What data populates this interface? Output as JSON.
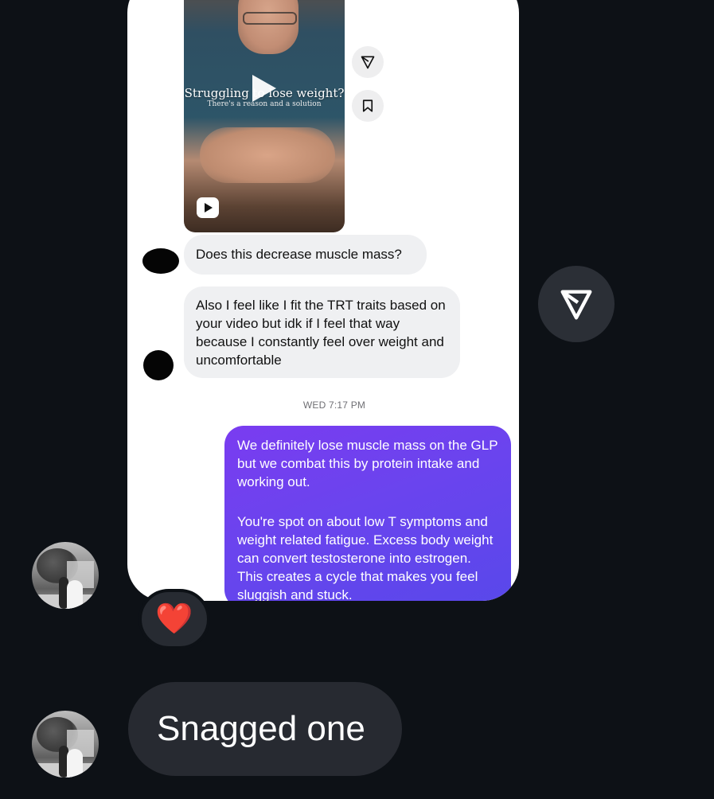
{
  "shared_screenshot": {
    "reel": {
      "caption_title": "Struggling to lose weight?",
      "caption_subtitle": "There's a reason and a solution"
    },
    "messages_in": [
      "Does this decrease muscle mass?",
      "Also I feel like I fit the TRT traits based on your video but idk if I feel that way because I constantly feel over weight and uncomfortable"
    ],
    "timestamp": "WED 7:17 PM",
    "message_out_paragraphs": [
      "We definitely lose muscle mass on the GLP but we combat this by protein intake and working out.",
      "You're spot on about low T symptoms and weight related fatigue. Excess body weight can convert testosterone into estrogen. This creates a cycle that makes you feel sluggish and stuck."
    ]
  },
  "reaction_emoji": "❤️",
  "reply_text": "Snagged one",
  "colors": {
    "background": "#0d1116",
    "bubble_dark": "#272a31",
    "bubble_purple_start": "#7a3cf0",
    "bubble_purple_end": "#5848ea"
  }
}
